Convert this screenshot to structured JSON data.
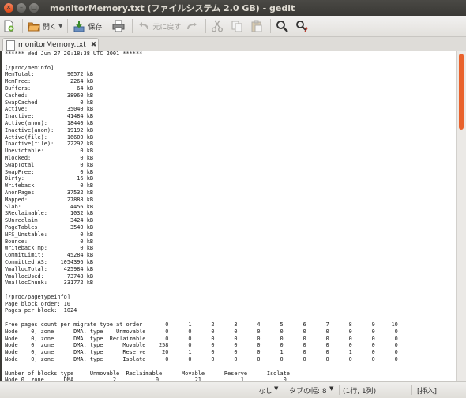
{
  "window": {
    "title": "monitorMemory.txt (ファイルシステム 2.0 GB) - gedit"
  },
  "toolbar": {
    "open_label": "開く",
    "save_label": "保存",
    "undo_label": "元に戻す"
  },
  "tab": {
    "label": "monitorMemory.txt"
  },
  "document": {
    "lines": [
      "****** Wed Jun 27 20:18:38 UTC 2001 ******",
      "",
      "[/proc/meminfo]",
      "MemTotal:          90572 kB",
      "MemFree:            2264 kB",
      "Buffers:              64 kB",
      "Cached:            38960 kB",
      "SwapCached:            0 kB",
      "Active:            35040 kB",
      "Inactive:          41484 kB",
      "Active(anon):      18440 kB",
      "Inactive(anon):    19192 kB",
      "Active(file):      16600 kB",
      "Inactive(file):    22292 kB",
      "Unevictable:           0 kB",
      "Mlocked:               0 kB",
      "SwapTotal:             0 kB",
      "SwapFree:              0 kB",
      "Dirty:                16 kB",
      "Writeback:             0 kB",
      "AnonPages:         37532 kB",
      "Mapped:            27888 kB",
      "Slab:               4456 kB",
      "SReclaimable:       1032 kB",
      "SUnreclaim:         3424 kB",
      "PageTables:         3540 kB",
      "NFS_Unstable:          0 kB",
      "Bounce:                0 kB",
      "WritebackTmp:          0 kB",
      "CommitLimit:       45284 kB",
      "Committed_AS:    1054396 kB",
      "VmallocTotal:     425984 kB",
      "VmallocUsed:       73748 kB",
      "VmallocChunk:     331772 kB",
      "",
      "[/proc/pagetypeinfo]",
      "Page block order: 10",
      "Pages per block:  1024",
      "",
      "Free pages count per migrate type at order       0      1      2      3      4      5      6      7      8      9     10",
      "Node    0, zone      DMA, type    Unmovable      0      0      0      0      0      0      0      0      0      0      0",
      "Node    0, zone      DMA, type  Reclaimable      0      0      0      0      0      0      0      0      0      0      0",
      "Node    0, zone      DMA, type      Movable    258      0      0      0      0      0      0      0      0      0      0",
      "Node    0, zone      DMA, type      Reserve     20      1      0      0      0      1      0      0      1      0      0",
      "Node    0, zone      DMA, type      Isolate      0      0      0      0      0      0      0      0      0      0      0",
      "",
      "Number of blocks type     Unmovable  Reclaimable      Movable      Reserve      Isolate",
      "Node 0, zone      DMA            2            0           21            1            0"
    ]
  },
  "statusbar": {
    "language": "なし",
    "tab_width": "タブの幅: 8",
    "position": "(1行, 1列)",
    "mode": "[挿入]"
  }
}
